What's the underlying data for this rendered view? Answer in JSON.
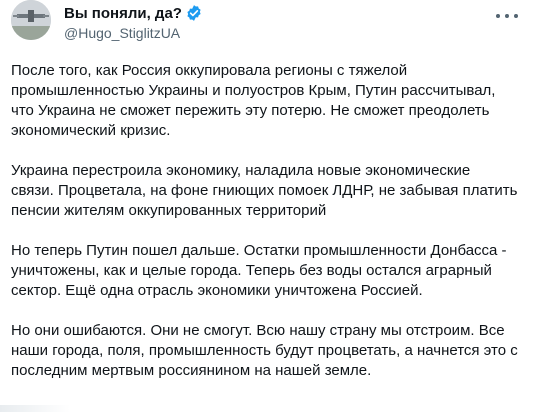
{
  "author": {
    "display_name": "Вы поняли, да?",
    "handle": "@Hugo_StiglitzUA",
    "verified": true,
    "avatar_icon": "avatar-icon"
  },
  "menu_icon": "more-dots-icon",
  "colors": {
    "verified_badge": "#1d9bf0",
    "handle_text": "#536471",
    "body_text": "#0f1419"
  },
  "paragraphs": [
    {
      "lines": [
        "После того, как Россия оккупировала регионы с тяжелой",
        "промышленностью Украины и полуостров Крым, Путин рассчитывал,",
        "что Украина не сможет пережить эту потерю. Не сможет преодолеть",
        "экономический кризис."
      ]
    },
    {
      "lines": [
        "Украина перестроила экономику, наладила новые экономические",
        "связи. Процветала, на фоне гниющих помоек ЛДНР, не забывая платить",
        "пенсии жителям оккупированных территорий"
      ]
    },
    {
      "lines": [
        "Но теперь Путин пошел дальше. Остатки промышленности Донбасса -",
        "уничтожены, как и целые города. Теперь без воды остался аграрный",
        "сектор. Ещё одна отрасль экономики уничтожена Россией."
      ]
    },
    {
      "lines": [
        "Но они ошибаются. Они не смогут. Всю нашу страну мы отстроим. Все",
        "наши города, поля, промышленность будут процветать, а начнется это с",
        "последним мертвым россиянином на нашей земле."
      ]
    }
  ]
}
